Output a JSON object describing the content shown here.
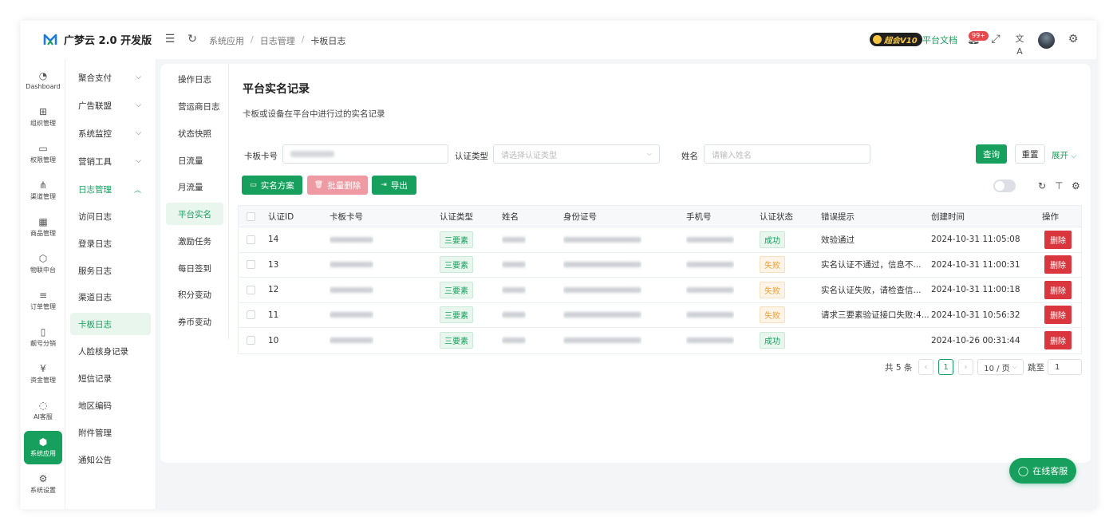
{
  "app": {
    "title": "广梦云 2.0 开发版",
    "vip_label": "超会V10",
    "docs_link": "平台文档",
    "notification_badge": "99+"
  },
  "breadcrumb": [
    "系统应用",
    "日志管理",
    "卡板日志"
  ],
  "rail": [
    {
      "label": "Dashboard",
      "icon": "dashboard-icon"
    },
    {
      "label": "组织管理",
      "icon": "grid-icon"
    },
    {
      "label": "权限管理",
      "icon": "laptop-icon"
    },
    {
      "label": "渠道管理",
      "icon": "network-icon"
    },
    {
      "label": "商品管理",
      "icon": "store-icon"
    },
    {
      "label": "物联中台",
      "icon": "cube-icon"
    },
    {
      "label": "订单管理",
      "icon": "list-icon"
    },
    {
      "label": "靓号分销",
      "icon": "phone-icon"
    },
    {
      "label": "资金管理",
      "icon": "yen-icon"
    },
    {
      "label": "AI客服",
      "icon": "ai-icon"
    },
    {
      "label": "系统应用",
      "icon": "app-icon",
      "active": true
    },
    {
      "label": "系统设置",
      "icon": "gear-icon"
    }
  ],
  "submenu": [
    {
      "label": "聚合支付",
      "chevron": "down"
    },
    {
      "label": "广告联盟",
      "chevron": "down"
    },
    {
      "label": "系统监控",
      "chevron": "down"
    },
    {
      "label": "营销工具",
      "chevron": "down"
    },
    {
      "label": "日志管理",
      "chevron": "up",
      "open": true
    },
    {
      "label": "访问日志"
    },
    {
      "label": "登录日志"
    },
    {
      "label": "服务日志"
    },
    {
      "label": "渠道日志"
    },
    {
      "label": "卡板日志",
      "active": true
    },
    {
      "label": "人脸核身记录"
    },
    {
      "label": "短信记录"
    },
    {
      "label": "地区编码"
    },
    {
      "label": "附件管理"
    },
    {
      "label": "通知公告"
    }
  ],
  "log_nav": [
    {
      "label": "操作日志"
    },
    {
      "label": "营运商日志"
    },
    {
      "label": "状态快照"
    },
    {
      "label": "日流量"
    },
    {
      "label": "月流量"
    },
    {
      "label": "平台实名",
      "active": true
    },
    {
      "label": "激励任务"
    },
    {
      "label": "每日签到"
    },
    {
      "label": "积分变动"
    },
    {
      "label": "券币变动"
    }
  ],
  "page": {
    "title": "平台实名记录",
    "description": "卡板或设备在平台中进行过的实名记录"
  },
  "filters": {
    "card_label": "卡板卡号",
    "auth_type_label": "认证类型",
    "auth_type_placeholder": "请选择认证类型",
    "name_label": "姓名",
    "name_placeholder": "请输入姓名",
    "query_button": "查询",
    "reset_button": "重置",
    "expand_link": "展开"
  },
  "toolbar": {
    "plan_button": "实名方案",
    "batch_delete_button": "批量删除",
    "export_button": "导出"
  },
  "table": {
    "headers": [
      "认证ID",
      "卡板卡号",
      "认证类型",
      "姓名",
      "身份证号",
      "手机号",
      "认证状态",
      "错误提示",
      "创建时间",
      "操作"
    ],
    "rows": [
      {
        "id": "14",
        "type": "三要素",
        "status": "成功",
        "status_kind": "success",
        "error": "效验通过",
        "created": "2024-10-31 11:05:08",
        "action": "删除"
      },
      {
        "id": "13",
        "type": "三要素",
        "status": "失败",
        "status_kind": "fail",
        "error": "实名认证不通过，信息不...",
        "created": "2024-10-31 11:00:31",
        "action": "删除"
      },
      {
        "id": "12",
        "type": "三要素",
        "status": "失败",
        "status_kind": "fail",
        "error": "实名认证失败，请检查信...",
        "created": "2024-10-31 11:00:18",
        "action": "删除"
      },
      {
        "id": "11",
        "type": "三要素",
        "status": "失败",
        "status_kind": "fail",
        "error": "请求三要素验证接口失败:4...",
        "created": "2024-10-31 10:56:32",
        "action": "删除"
      },
      {
        "id": "10",
        "type": "三要素",
        "status": "成功",
        "status_kind": "success",
        "error": "",
        "created": "2024-10-26 00:31:44",
        "action": "删除"
      }
    ]
  },
  "pagination": {
    "total": "共 5 条",
    "current_page": "1",
    "page_size": "10 / 页",
    "goto_label": "跳至",
    "goto_value": "1"
  },
  "support_button": "在线客服",
  "colors": {
    "accent": "#17a05d",
    "danger": "#d9363e",
    "warning": "#e6a23c"
  }
}
